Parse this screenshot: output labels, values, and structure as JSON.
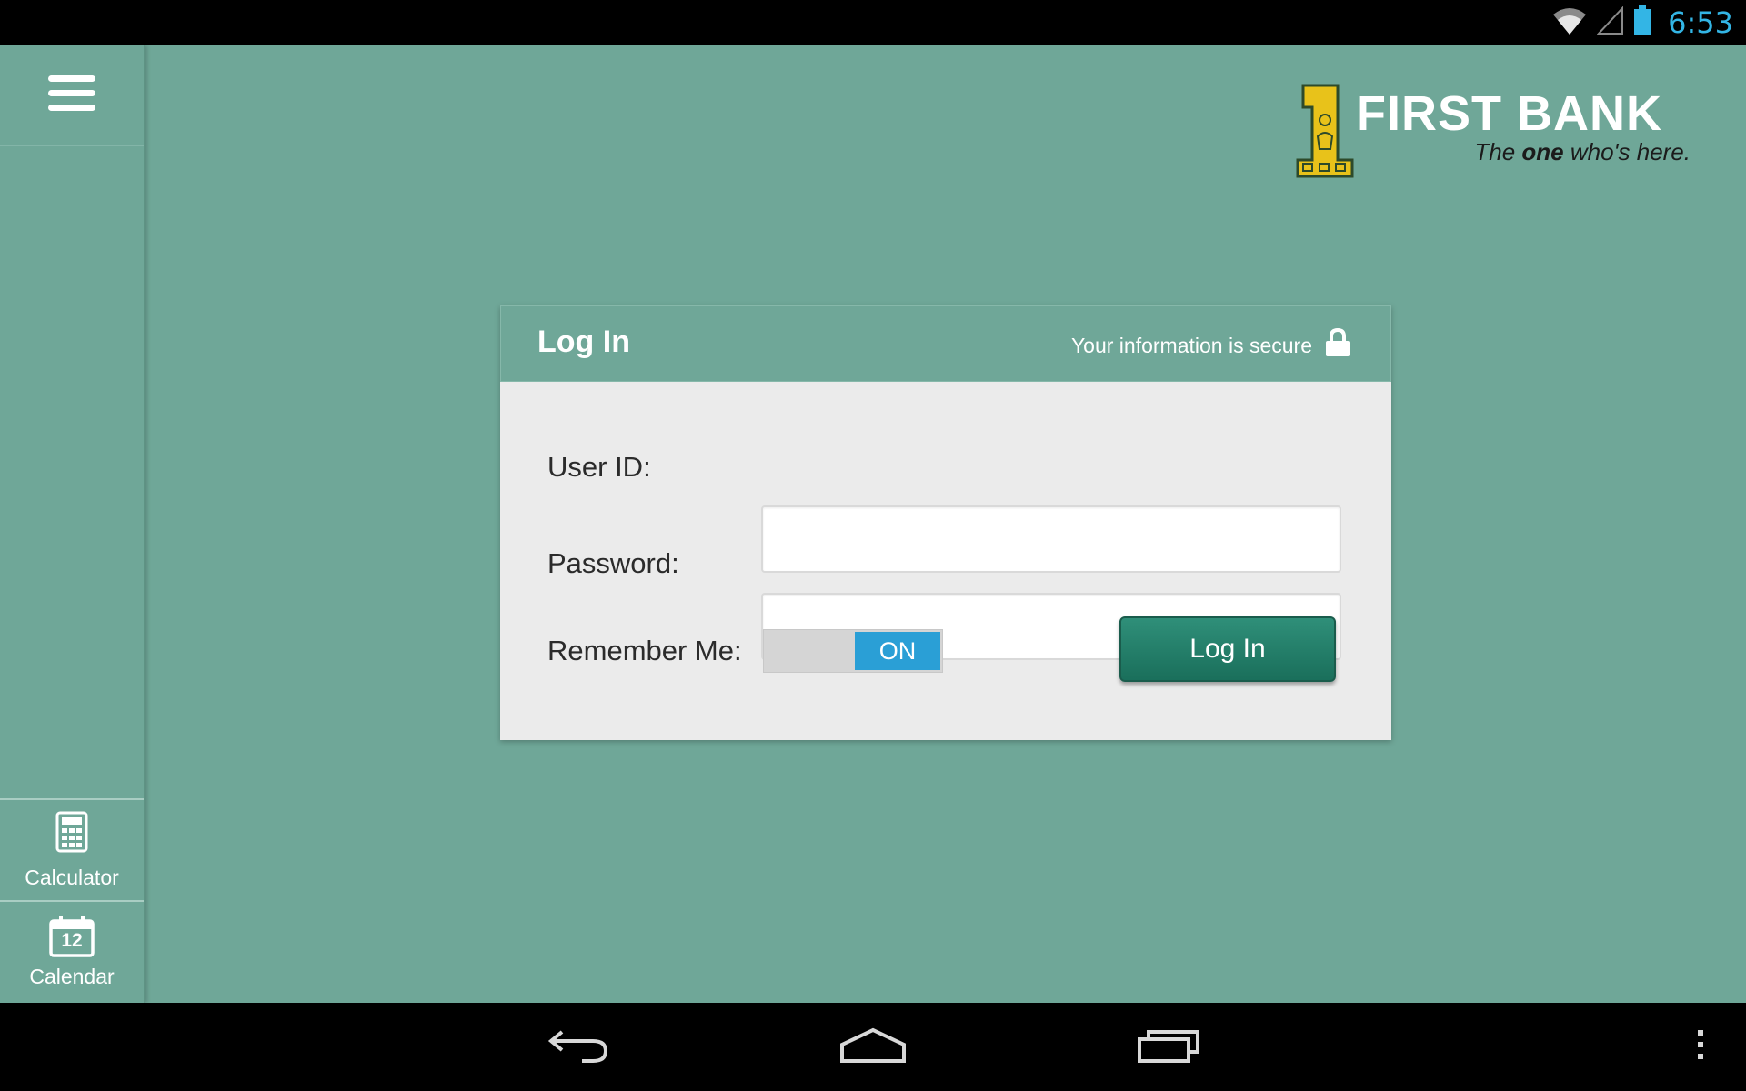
{
  "status_bar": {
    "time": "6:53",
    "icons": [
      "wifi-icon",
      "cell-signal-icon",
      "battery-icon"
    ],
    "time_color": "#33b5e5"
  },
  "sidebar": {
    "menu_icon": "hamburger-menu-icon",
    "items": [
      {
        "label": "Calculator",
        "icon": "calculator-icon"
      },
      {
        "label": "Calendar",
        "icon": "calendar-icon",
        "icon_text": "12"
      }
    ]
  },
  "logo": {
    "name": "FIRST BANK",
    "tagline_pre": "The ",
    "tagline_bold": "one",
    "tagline_post": " who's here."
  },
  "login_card": {
    "title": "Log In",
    "secure_text": "Your information is secure",
    "user_id_label": "User ID:",
    "user_id_value": "",
    "password_label": "Password:",
    "password_value": "",
    "remember_label": "Remember Me:",
    "remember_state": "ON",
    "submit_label": "Log In"
  },
  "nav_bar": {
    "buttons": [
      "back-icon",
      "home-icon",
      "recent-apps-icon",
      "overflow-menu-icon"
    ]
  },
  "colors": {
    "background": "#6fa798",
    "card_body": "#ebebeb",
    "toggle_on": "#2a9fd6",
    "button": "#1f7a64",
    "logo_gold": "#e8c21a"
  }
}
